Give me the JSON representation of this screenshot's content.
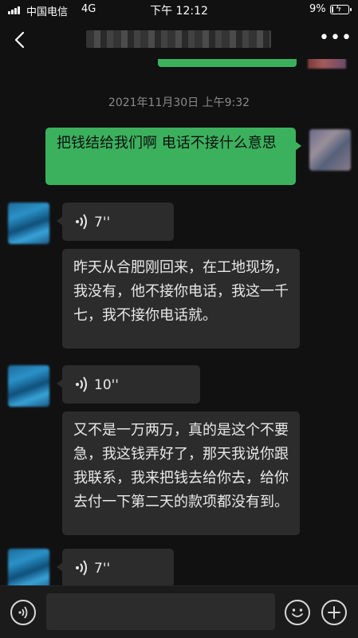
{
  "status_bar": {
    "carrier": "中国电信",
    "network": "4G",
    "time": "下午 12:12",
    "battery_percent_label": "9%",
    "battery_level": 0.09,
    "signal_icon": "signal-bars-icon",
    "battery_icon": "battery-charging-icon"
  },
  "nav": {
    "back_icon": "chevron-left-icon",
    "more_icon": "more-dots-icon",
    "more_label": "•••"
  },
  "chat": {
    "timestamp": "2021年11月30日 上午9:32",
    "messages": [
      {
        "direction": "out",
        "type": "text",
        "text": "把钱结给我们啊   电话不接什么意思"
      },
      {
        "direction": "in",
        "type": "voice",
        "duration": "7''",
        "transcript": "昨天从合肥刚回来，在工地现场，我没有，他不接你电话，我这一千七，我不接你电话就。"
      },
      {
        "direction": "in",
        "type": "voice",
        "duration": "10''",
        "transcript": "又不是一万两万，真的是这个不要急，我这钱弄好了，那天我说你跟我联系，我来把钱去给你去，给你去付一下第二天的款项都没有到。"
      },
      {
        "direction": "in",
        "type": "voice",
        "duration": "7''",
        "transcript": ""
      }
    ]
  },
  "input_bar": {
    "voice_icon": "voice-mode-icon",
    "emoji_icon": "emoji-icon",
    "plus_icon": "plus-icon",
    "placeholder": ""
  },
  "colors": {
    "background": "#111111",
    "outgoing_bubble": "#3cb15d",
    "incoming_bubble": "#2c2c2c",
    "timestamp": "#8a8a8a"
  }
}
